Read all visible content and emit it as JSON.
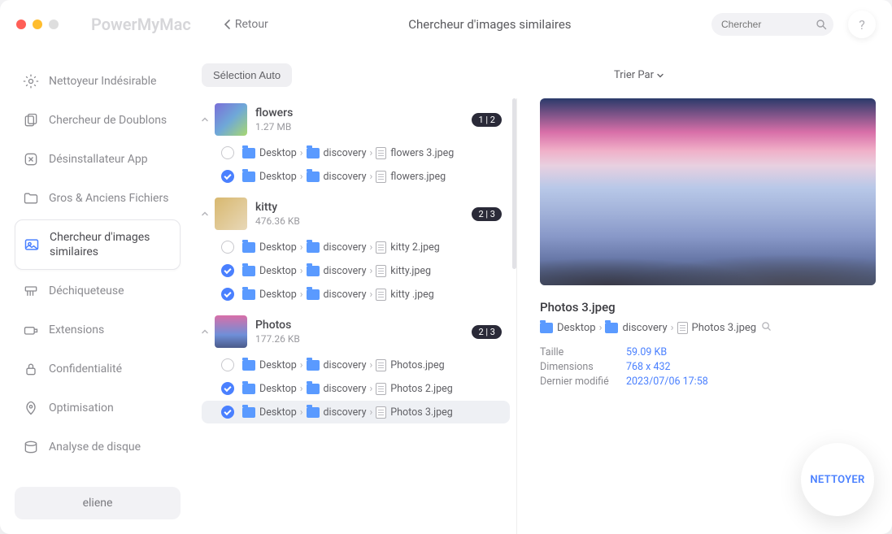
{
  "app_name": "PowerMyMac",
  "header": {
    "back_label": "Retour",
    "page_title": "Chercheur d'images similaires",
    "search_placeholder": "Chercher",
    "help_symbol": "?"
  },
  "sidebar": {
    "items": [
      {
        "label": "Nettoyeur Indésirable"
      },
      {
        "label": "Chercheur de Doublons"
      },
      {
        "label": "Désinstallateur App"
      },
      {
        "label": "Gros & Anciens Fichiers"
      },
      {
        "label": "Chercheur d'images similaires"
      },
      {
        "label": "Déchiqueteuse"
      },
      {
        "label": "Extensions"
      },
      {
        "label": "Confidentialité"
      },
      {
        "label": "Optimisation"
      },
      {
        "label": "Analyse de disque"
      }
    ],
    "user": "eliene"
  },
  "toolbar": {
    "auto_select": "Sélection Auto",
    "sort_label": "Trier Par"
  },
  "groups": [
    {
      "name": "flowers",
      "size": "1.27 MB",
      "badge": "1 | 2",
      "thumb": "flowers",
      "files": [
        {
          "checked": false,
          "crumbs": [
            "Desktop",
            "discovery"
          ],
          "name": "flowers 3.jpeg"
        },
        {
          "checked": true,
          "crumbs": [
            "Desktop",
            "discovery"
          ],
          "name": "flowers.jpeg"
        }
      ]
    },
    {
      "name": "kitty",
      "size": "476.36 KB",
      "badge": "2 | 3",
      "thumb": "kitty",
      "files": [
        {
          "checked": false,
          "crumbs": [
            "Desktop",
            "discovery"
          ],
          "name": "kitty 2.jpeg"
        },
        {
          "checked": true,
          "crumbs": [
            "Desktop",
            "discovery"
          ],
          "name": "kitty.jpeg"
        },
        {
          "checked": true,
          "crumbs": [
            "Desktop",
            "discovery"
          ],
          "name": "kitty .jpeg"
        }
      ]
    },
    {
      "name": "Photos",
      "size": "177.26 KB",
      "badge": "2 | 3",
      "thumb": "photos",
      "files": [
        {
          "checked": false,
          "crumbs": [
            "Desktop",
            "discovery"
          ],
          "name": "Photos.jpeg"
        },
        {
          "checked": true,
          "crumbs": [
            "Desktop",
            "discovery"
          ],
          "name": "Photos 2.jpeg"
        },
        {
          "checked": true,
          "crumbs": [
            "Desktop",
            "discovery"
          ],
          "name": "Photos 3.jpeg",
          "selected": true
        }
      ]
    }
  ],
  "preview": {
    "name": "Photos 3.jpeg",
    "crumbs": [
      "Desktop",
      "discovery"
    ],
    "file": "Photos 3.jpeg",
    "meta": {
      "size_label": "Taille",
      "size_value": "59.09 KB",
      "dim_label": "Dimensions",
      "dim_value": "768 x 432",
      "mod_label": "Dernier modifié",
      "mod_value": "2023/07/06 17:58"
    }
  },
  "clean_label": "NETTOYER"
}
